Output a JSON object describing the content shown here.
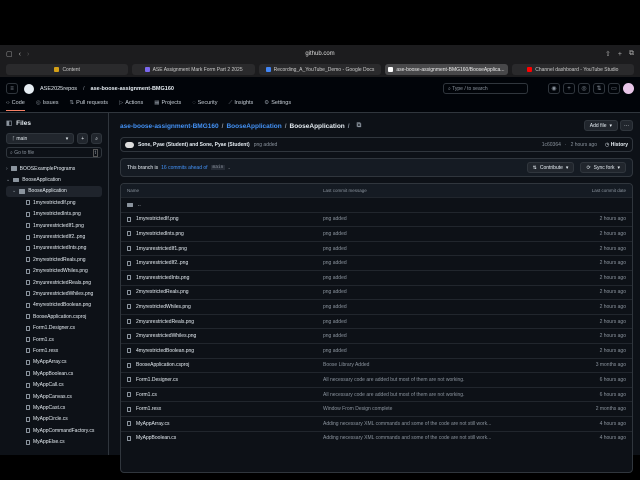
{
  "browser": {
    "url": "github.com",
    "tabs": [
      {
        "label": "Content",
        "color": "#d4a017",
        "active": false
      },
      {
        "label": "ASE Assignment Mark Form Part 2 2025",
        "color": "#7b68ee",
        "active": false
      },
      {
        "label": "Recording_A_YouTube_Demo - Google Docs",
        "color": "#4285f4",
        "active": false
      },
      {
        "label": "ase-boose-assignment-BMG160/BooseApplica...",
        "color": "#ffffff",
        "active": true
      },
      {
        "label": "Channel dashboard - YouTube Studio",
        "color": "#ff0000",
        "active": false
      }
    ]
  },
  "header": {
    "owner": "ASE2025repos",
    "repo": "ase-boose-assignment-BMG160",
    "search_placeholder": "Type / to search",
    "nav": [
      "Code",
      "Issues",
      "Pull requests",
      "Actions",
      "Projects",
      "Security",
      "Insights",
      "Settings"
    ]
  },
  "sidebar": {
    "title": "Files",
    "branch": "main",
    "goto_placeholder": "Go to file",
    "goto_key": "t",
    "tree": [
      {
        "label": "BOOSExamplePrograms",
        "type": "folder",
        "depth": 0
      },
      {
        "label": "BooseApplication",
        "type": "folder",
        "depth": 0
      },
      {
        "label": "BooseApplication",
        "type": "folder",
        "depth": 1,
        "selected": true
      },
      {
        "label": "1myrestrictedIf.png",
        "type": "file",
        "depth": 2
      },
      {
        "label": "1myrestrictedInts.png",
        "type": "file",
        "depth": 2
      },
      {
        "label": "1myunrestrictedIf1.png",
        "type": "file",
        "depth": 2
      },
      {
        "label": "1myunrestrictedIf2..png",
        "type": "file",
        "depth": 2
      },
      {
        "label": "1myunrestrictedInts.png",
        "type": "file",
        "depth": 2
      },
      {
        "label": "2myrestrictedReals.png",
        "type": "file",
        "depth": 2
      },
      {
        "label": "2myrestrictedWhiles.png",
        "type": "file",
        "depth": 2
      },
      {
        "label": "2myunrestrictedReals.png",
        "type": "file",
        "depth": 2
      },
      {
        "label": "2myunrestrictedWhiles.png",
        "type": "file",
        "depth": 2
      },
      {
        "label": "4myrestrictedBoolean.png",
        "type": "file",
        "depth": 2
      },
      {
        "label": "BooseApplication.csproj",
        "type": "file",
        "depth": 2
      },
      {
        "label": "Form1.Designer.cs",
        "type": "file",
        "depth": 2
      },
      {
        "label": "Form1.cs",
        "type": "file",
        "depth": 2
      },
      {
        "label": "Form1.resx",
        "type": "file",
        "depth": 2
      },
      {
        "label": "MyAppArray.cs",
        "type": "file",
        "depth": 2
      },
      {
        "label": "MyAppBoolean.cs",
        "type": "file",
        "depth": 2
      },
      {
        "label": "MyAppCall.cs",
        "type": "file",
        "depth": 2
      },
      {
        "label": "MyAppCanvas.cs",
        "type": "file",
        "depth": 2
      },
      {
        "label": "MyAppCast.cs",
        "type": "file",
        "depth": 2
      },
      {
        "label": "MyAppCircle.cs",
        "type": "file",
        "depth": 2
      },
      {
        "label": "MyAppCommandFactory.cs",
        "type": "file",
        "depth": 2
      },
      {
        "label": "MyAppElse.cs",
        "type": "file",
        "depth": 2
      }
    ]
  },
  "main": {
    "breadcrumb": [
      "ase-boose-assignment-BMG160",
      "BooseApplication",
      "BooseApplication"
    ],
    "add_file": "Add file",
    "commit": {
      "authors": "Sone, Pyae (Student) and Sone, Pyae (Student)",
      "message": "png added",
      "hash": "1c60364",
      "time": "2 hours ago",
      "history": "History"
    },
    "branch_notice": {
      "prefix": "This branch is",
      "link": "16 commits ahead of",
      "base": "main",
      "suffix": "."
    },
    "contribute": "Contribute",
    "sync": "Sync fork",
    "columns": [
      "Name",
      "Last commit message",
      "Last commit date"
    ],
    "parent": "..",
    "files": [
      {
        "name": "1myrestrictedIf.png",
        "msg": "png added",
        "date": "2 hours ago"
      },
      {
        "name": "1myrestrictedInts.png",
        "msg": "png added",
        "date": "2 hours ago"
      },
      {
        "name": "1myunrestrictedIf1.png",
        "msg": "png added",
        "date": "2 hours ago"
      },
      {
        "name": "1myunrestrictedIf2..png",
        "msg": "png added",
        "date": "2 hours ago"
      },
      {
        "name": "1myunrestrictedInts.png",
        "msg": "png added",
        "date": "2 hours ago"
      },
      {
        "name": "2myrestrictedReals.png",
        "msg": "png added",
        "date": "2 hours ago"
      },
      {
        "name": "2myrestrictedWhiles.png",
        "msg": "png added",
        "date": "2 hours ago"
      },
      {
        "name": "2myunrestrictedReals.png",
        "msg": "png added",
        "date": "2 hours ago"
      },
      {
        "name": "2myunrestrictedWhiles.png",
        "msg": "png added",
        "date": "2 hours ago"
      },
      {
        "name": "4myrestrictedBoolean.png",
        "msg": "png added",
        "date": "2 hours ago"
      },
      {
        "name": "BooseApplication.csproj",
        "msg": "Boose Library Added",
        "date": "3 months ago"
      },
      {
        "name": "Form1.Designer.cs",
        "msg": "All necessary code are added but most of them are not working.",
        "date": "6 hours ago"
      },
      {
        "name": "Form1.cs",
        "msg": "All necessary code are added but most of them are not working.",
        "date": "6 hours ago"
      },
      {
        "name": "Form1.resx",
        "msg": "Window From Design complete",
        "date": "2 months ago"
      },
      {
        "name": "MyAppArray.cs",
        "msg": "Adding necessary XML commands and some of the code are not still work...",
        "date": "4 hours ago"
      },
      {
        "name": "MyAppBoolean.cs",
        "msg": "Adding necessary XML commands and some of the code are not still work...",
        "date": "4 hours ago"
      }
    ]
  }
}
